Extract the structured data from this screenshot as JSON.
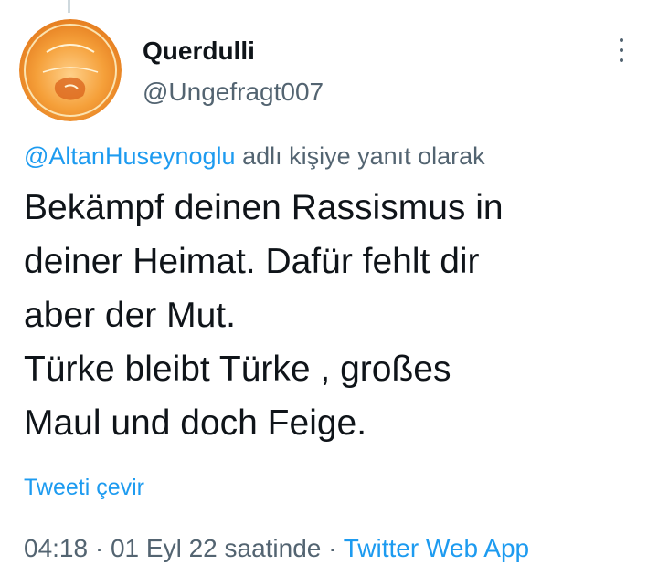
{
  "tweet": {
    "author": {
      "display_name": "Querdulli",
      "handle": "@Ungefragt007",
      "avatar_icon": "profile-avatar-image"
    },
    "more_icon": "more-vertical-icon",
    "reply_context": {
      "mention": "@AltanHuseynoglu",
      "suffix": "adlı kişiye yanıt olarak"
    },
    "text_lines": [
      "Bekämpf deinen Rassismus in",
      "deiner Heimat. Dafür fehlt dir",
      "aber der Mut.",
      "Türke bleibt Türke , großes",
      "Maul und doch Feige."
    ],
    "translate_label": "Tweeti çevir",
    "meta": {
      "time": "04:18",
      "separator": "·",
      "date": "01 Eyl 22 saatinde",
      "source": "Twitter Web App"
    },
    "colors": {
      "accent": "#1d9bf0",
      "text": "#0f1419",
      "secondary": "#536471",
      "avatar_orange": "#f28c1e"
    }
  }
}
